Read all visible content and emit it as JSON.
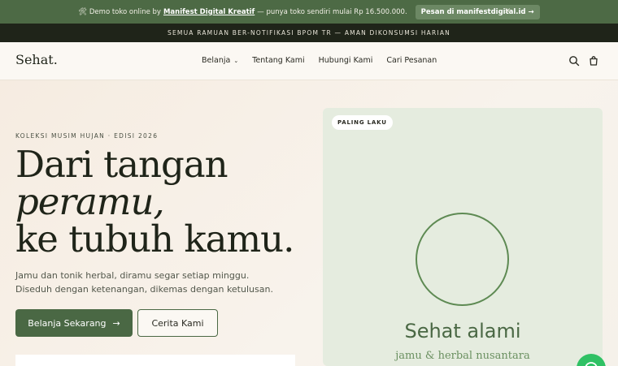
{
  "promo": {
    "prefix": "🛠 Demo toko online by",
    "brand": "Manifest Digital Kreatif",
    "suffix": "— punya toko sendiri mulai Rp 16.500.000.",
    "button": "Pesan di manifestdigital.id →",
    "close": "×"
  },
  "notice": "SEMUA RAMUAN BER-NOTIFIKASI BPOM TR — AMAN DIKONSUMSI HARIAN",
  "header": {
    "logo": "Sehat.",
    "nav": [
      "Belanja",
      "Tentang Kami",
      "Hubungi Kami",
      "Cari Pesanan"
    ],
    "icons": [
      "search-icon",
      "cart-icon"
    ]
  },
  "hero": {
    "eyebrow": "KOLEKSI MUSIM HUJAN · EDISI 2026",
    "headline_1": "Dari tangan",
    "headline_2": "peramu,",
    "headline_3": "ke tubuh kamu.",
    "sub_1": "Jamu dan tonik herbal, diramu segar setiap minggu.",
    "sub_2": "Diseduh dengan ketenangan, dikemas dengan ketulusan.",
    "primary_cta": "Belanja Sekarang",
    "secondary_cta": "Cerita Kami"
  },
  "product": {
    "badge": "PALING LAKU",
    "title": "Sehat alami",
    "subtitle": "jamu & herbal nusantara"
  },
  "colors": {
    "brand_green": "#4a6844",
    "promo_bar": "#4d6a45",
    "notice_bar": "#1f2419",
    "whatsapp": "#2fc164"
  }
}
